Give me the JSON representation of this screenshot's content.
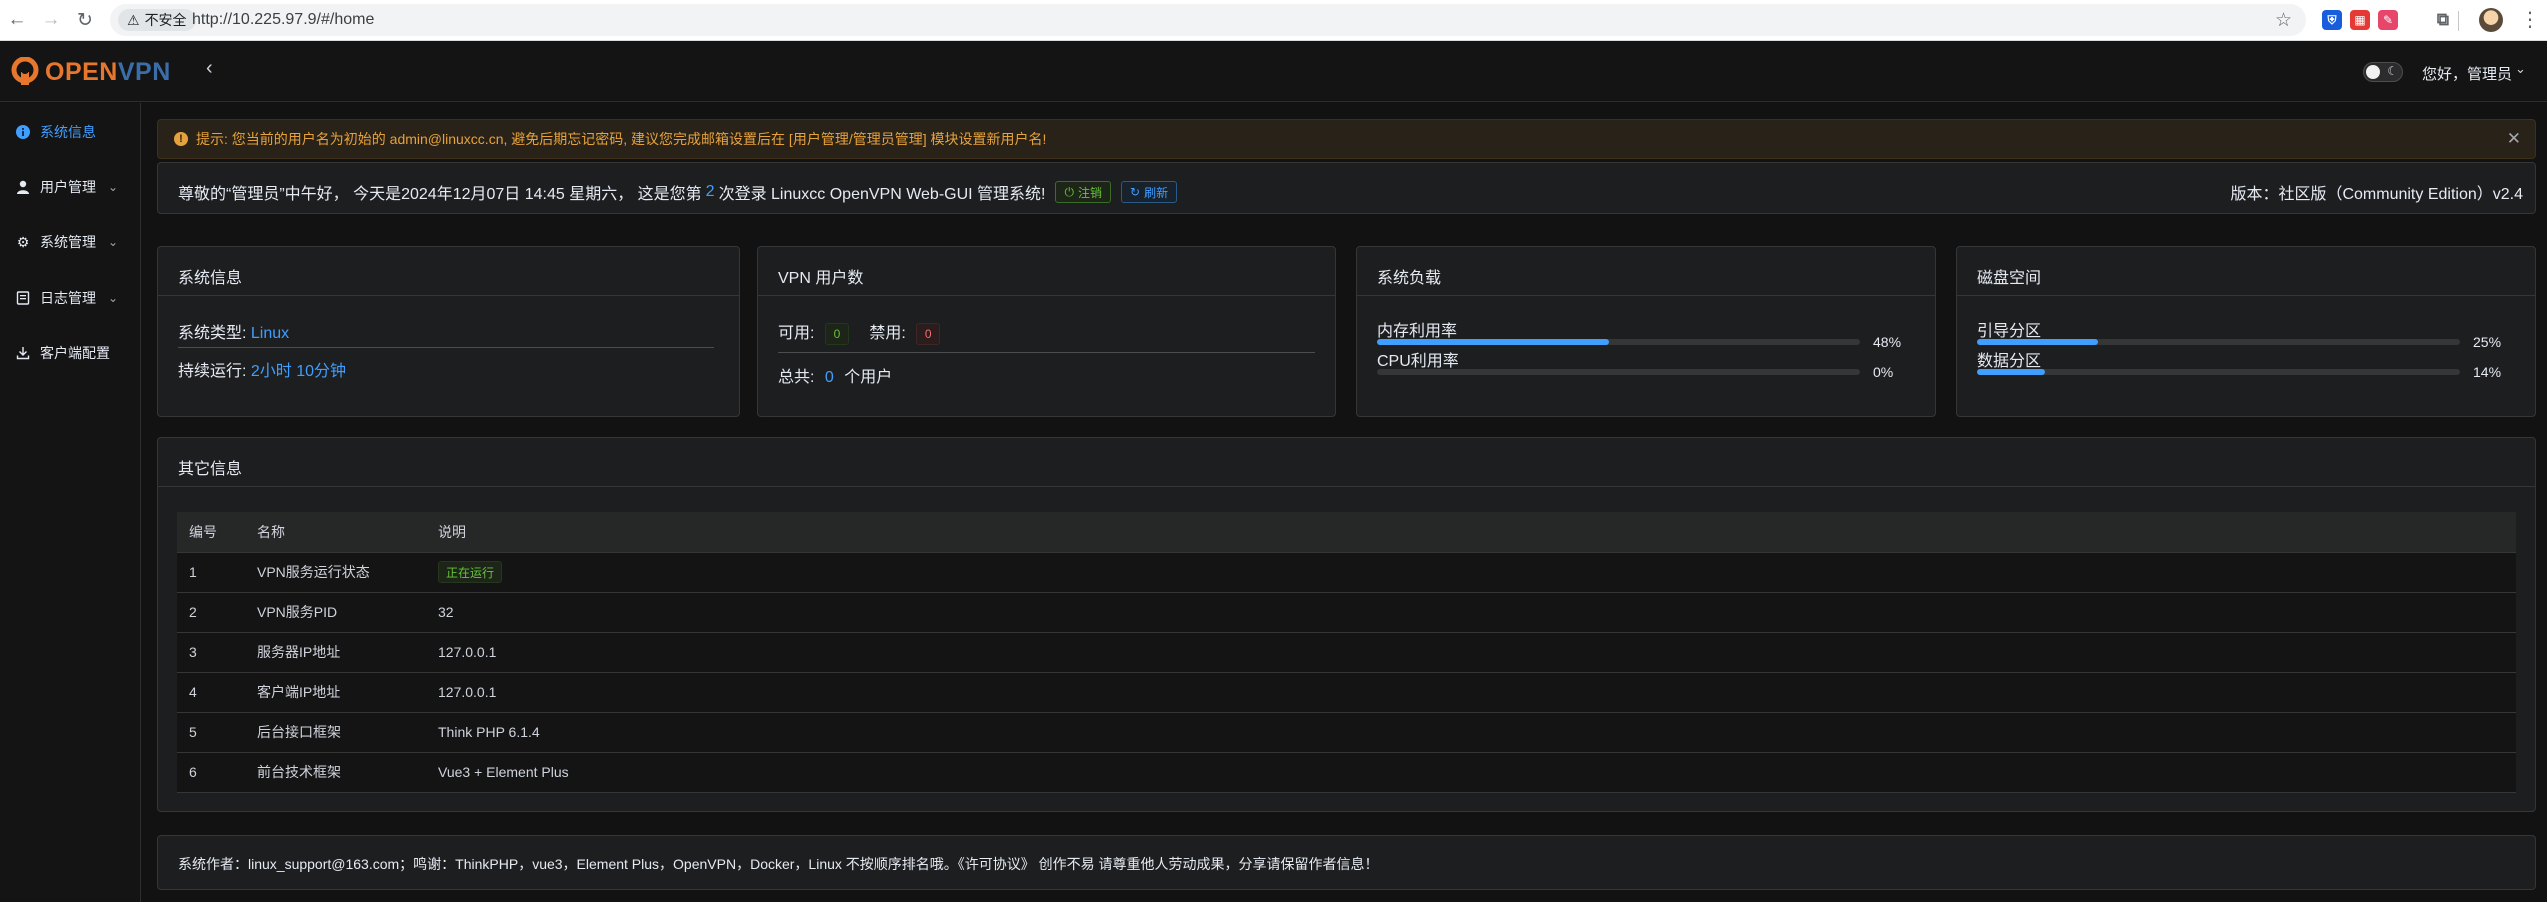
{
  "browser": {
    "insecure_label": "不安全",
    "url": "http://10.225.97.9/#/home",
    "extensions": [
      {
        "name": "bitwarden-icon",
        "color": "#175ddc",
        "glyph": "⛨"
      },
      {
        "name": "extension-red-icon",
        "color": "#e53935",
        "glyph": "▦"
      },
      {
        "name": "extension-pink-icon",
        "color": "#e8456b",
        "glyph": "✎"
      }
    ]
  },
  "header": {
    "logo_open": "OPEN",
    "logo_vpn": "VPN",
    "greeting": "您好，管理员"
  },
  "sidebar": {
    "items": [
      {
        "label": "系统信息",
        "icon": "info-icon",
        "active": true
      },
      {
        "label": "用户管理",
        "icon": "user-icon",
        "active": false
      },
      {
        "label": "系统管理",
        "icon": "gear-icon",
        "active": false
      },
      {
        "label": "日志管理",
        "icon": "log-icon",
        "active": false
      },
      {
        "label": "客户端配置",
        "icon": "download-icon",
        "active": false
      }
    ]
  },
  "alert": {
    "text": "提示: 您当前的用户名为初始的 admin@linuxcc.cn, 避免后期忘记密码, 建议您完成邮箱设置后在 [用户管理/管理员管理] 模块设置新用户名!"
  },
  "welcome": {
    "before": "尊敬的“管理员”中午好， 今天是2024年12月07日 14:45 星期六， 这是您第",
    "count": "2",
    "after": "次登录 Linuxcc OpenVPN Web-GUI 管理系统!",
    "logout_label": "注销",
    "refresh_label": "刷新",
    "version": "版本：社区版（Community Edition）v2.4"
  },
  "system_info": {
    "title": "系统信息",
    "type_label": "系统类型:",
    "type_value": "Linux",
    "uptime_label": "持续运行:",
    "uptime_value": "2小时 10分钟"
  },
  "vpn_users": {
    "title": "VPN 用户数",
    "enabled_label": "可用:",
    "enabled_value": "0",
    "disabled_label": "禁用:",
    "disabled_value": "0",
    "total_label": "总共:",
    "total_value": "0",
    "total_unit": "个用户"
  },
  "load": {
    "title": "系统负载",
    "items": [
      {
        "label": "内存利用率",
        "percent": 48,
        "percent_text": "48%"
      },
      {
        "label": "CPU利用率",
        "percent": 0,
        "percent_text": "0%"
      }
    ]
  },
  "disk": {
    "title": "磁盘空间",
    "items": [
      {
        "label": "引导分区",
        "percent": 25,
        "percent_text": "25%"
      },
      {
        "label": "数据分区",
        "percent": 14,
        "percent_text": "14%"
      }
    ]
  },
  "other": {
    "title": "其它信息",
    "columns": [
      "编号",
      "名称",
      "说明"
    ],
    "rows": [
      {
        "id": "1",
        "name": "VPN服务运行状态",
        "desc": "正在运行",
        "tag": true
      },
      {
        "id": "2",
        "name": "VPN服务PID",
        "desc": "32",
        "tag": false
      },
      {
        "id": "3",
        "name": "服务器IP地址",
        "desc": "127.0.0.1",
        "tag": false
      },
      {
        "id": "4",
        "name": "客户端IP地址",
        "desc": "127.0.0.1",
        "tag": false
      },
      {
        "id": "5",
        "name": "后台接口框架",
        "desc": "Think PHP 6.1.4",
        "tag": false
      },
      {
        "id": "6",
        "name": "前台技术框架",
        "desc": "Vue3 + Element Plus",
        "tag": false
      }
    ]
  },
  "footer": {
    "text": "系统作者：linux_support@163.com；鸣谢：ThinkPHP，vue3，Element Plus，OpenVPN，Docker，Linux 不按顺序排名哦。《许可协议》 创作不易 请尊重他人劳动成果，分享请保留作者信息！"
  },
  "colors": {
    "accent": "#409eff",
    "success": "#67c23a",
    "danger": "#f56c6c",
    "warning": "#e6a23c",
    "logo_orange": "#e8772e",
    "logo_blue": "#3b6ea8"
  }
}
